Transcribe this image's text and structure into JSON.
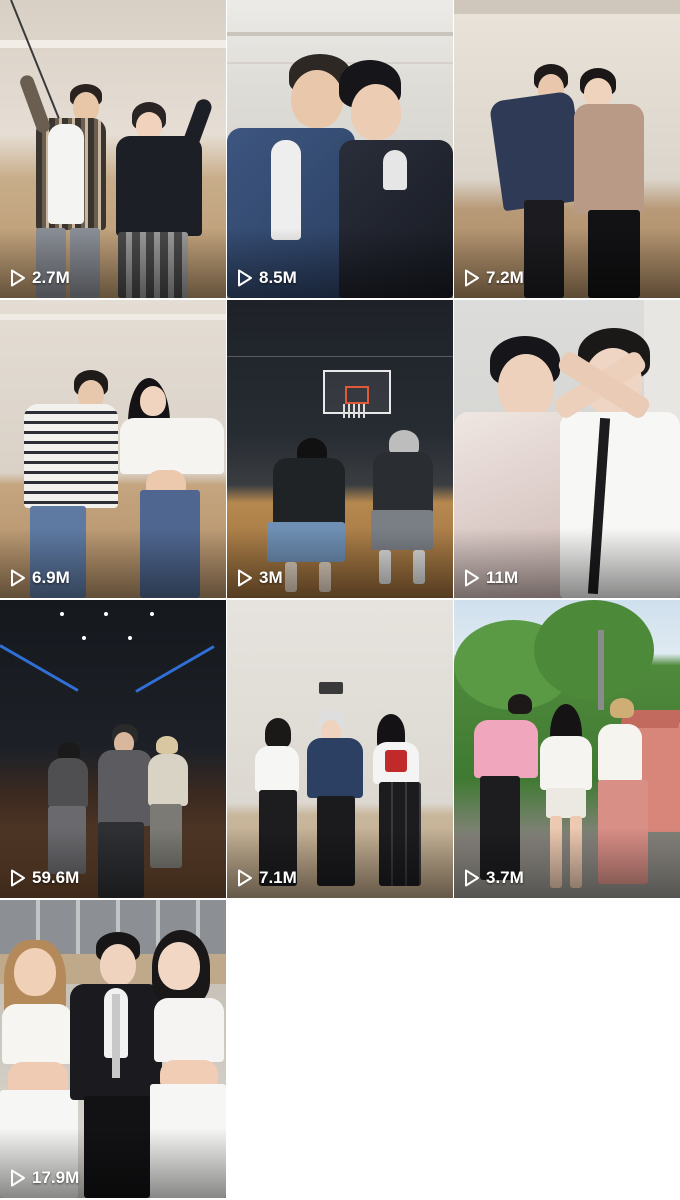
{
  "videos": [
    {
      "views": "2.7M"
    },
    {
      "views": "8.5M"
    },
    {
      "views": "7.2M"
    },
    {
      "views": "6.9M"
    },
    {
      "views": "3M"
    },
    {
      "views": "11M"
    },
    {
      "views": "59.6M"
    },
    {
      "views": "7.1M"
    },
    {
      "views": "3.7M"
    },
    {
      "views": "17.9M"
    }
  ],
  "icons": {
    "play": "play-icon"
  },
  "colors": {
    "background": "#ffffff",
    "text": "#ffffff"
  }
}
